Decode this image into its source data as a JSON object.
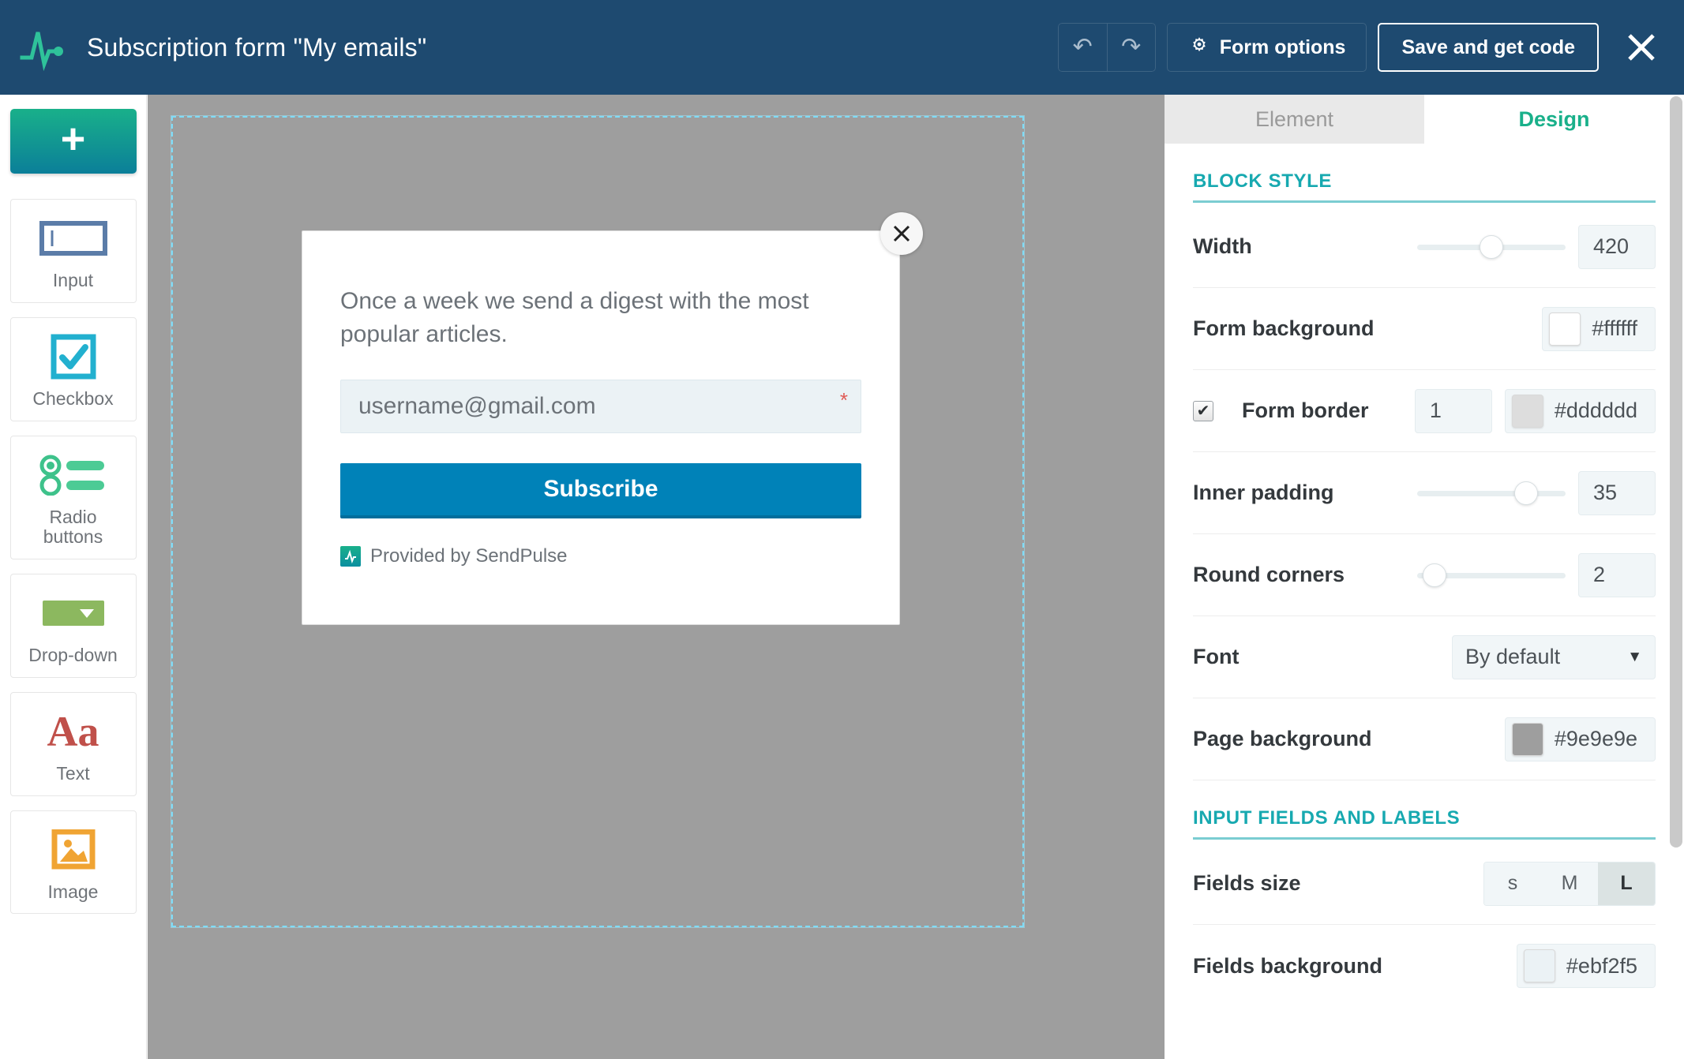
{
  "header": {
    "logo_icon": "sendpulse-pulse-logo",
    "title": "Subscription form \"My emails\"",
    "undo_label": "↶",
    "redo_label": "↷",
    "undo_icon": "undo-arrow-icon",
    "redo_icon": "redo-arrow-icon",
    "form_options_label": "Form options",
    "form_options_icon": "gear-icon",
    "save_label": "Save and get code",
    "close_icon": "close-x-icon",
    "bg_color": "#1e4a70"
  },
  "sidebar": {
    "add_button": {
      "label": "+",
      "icon": "plus-icon"
    },
    "items": [
      {
        "label": "Input",
        "icon": "text-input-icon"
      },
      {
        "label": "Checkbox",
        "icon": "checkbox-icon"
      },
      {
        "label": "Radio\nbuttons",
        "label_line1": "Radio",
        "label_line2": "buttons",
        "icon": "radio-buttons-icon"
      },
      {
        "label": "Drop-down",
        "icon": "dropdown-icon"
      },
      {
        "label": "Text",
        "icon": "text-aa-icon",
        "glyph": "Aa"
      },
      {
        "label": "Image",
        "icon": "image-icon"
      }
    ]
  },
  "canvas": {
    "page_background": "#9e9e9e",
    "selection_outline_color": "#7fdcf7",
    "form": {
      "close_icon": "close-x-icon",
      "description": "Once a week we send a digest with the most popular articles.",
      "email_placeholder": "username@gmail.com",
      "required_marker": "*",
      "submit_label": "Subscribe",
      "footer_text": "Provided by SendPulse",
      "footer_icon": "sendpulse-logo-icon",
      "background": "#ffffff",
      "border_color": "#dddddd",
      "field_background": "#ebf2f5",
      "button_color": "#0082b8"
    }
  },
  "right_panel": {
    "tabs": [
      {
        "label": "Element",
        "active": false
      },
      {
        "label": "Design",
        "active": true
      }
    ],
    "sections": [
      {
        "title": "BLOCK STYLE",
        "rows": [
          {
            "label": "Width",
            "value": "420",
            "slider_pct": 50
          },
          {
            "label": "Form background",
            "hex": "#ffffff",
            "swatch": "#ffffff"
          },
          {
            "label": "Form border",
            "checkbox": true,
            "checkbox_glyph": "✔",
            "value": "1",
            "hex": "#dddddd",
            "swatch": "#dddddd"
          },
          {
            "label": "Inner padding",
            "value": "35",
            "slider_pct": 78
          },
          {
            "label": "Round corners",
            "value": "2",
            "slider_pct": 5
          },
          {
            "label": "Font",
            "select_value": "By default",
            "caret": "▼"
          },
          {
            "label": "Page background",
            "hex": "#9e9e9e",
            "swatch": "#9e9e9e"
          }
        ]
      },
      {
        "title": "INPUT FIELDS AND LABELS",
        "rows": [
          {
            "label": "Fields size",
            "segments": [
              "s",
              "M",
              "L"
            ],
            "active_segment": "L"
          },
          {
            "label": "Fields background",
            "hex": "#ebf2f5",
            "swatch": "#ebf2f5"
          }
        ]
      }
    ],
    "scrollbar": {
      "name": "panel-scrollbar"
    }
  }
}
